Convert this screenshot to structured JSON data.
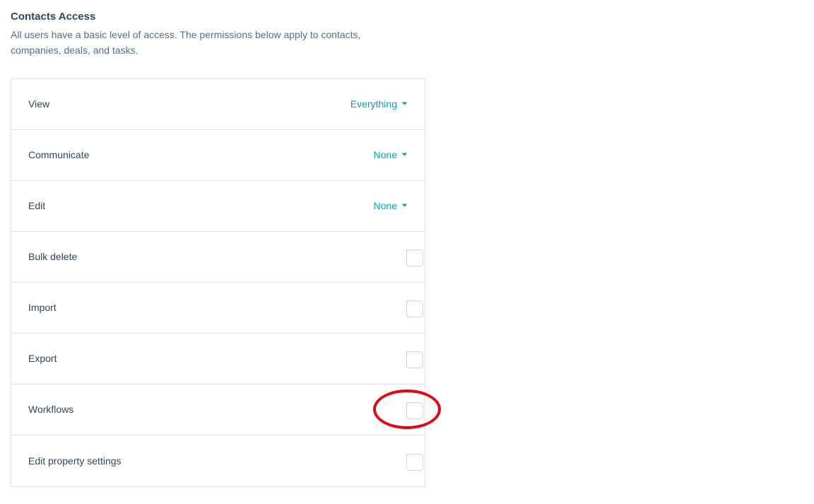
{
  "section": {
    "title": "Contacts Access",
    "description": "All users have a basic level of access. The permissions below apply to contacts, companies, deals, and tasks."
  },
  "rows": {
    "view": {
      "label": "View",
      "value": "Everything"
    },
    "communicate": {
      "label": "Communicate",
      "value": "None"
    },
    "edit": {
      "label": "Edit",
      "value": "None"
    },
    "bulk_delete": {
      "label": "Bulk delete"
    },
    "import": {
      "label": "Import"
    },
    "export": {
      "label": "Export"
    },
    "workflows": {
      "label": "Workflows"
    },
    "edit_property_settings": {
      "label": "Edit property settings"
    }
  }
}
